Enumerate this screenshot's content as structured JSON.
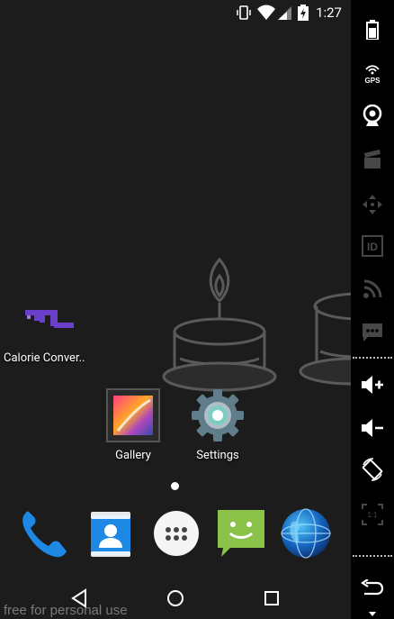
{
  "status_bar": {
    "time": "1:27"
  },
  "home": {
    "widget_app": {
      "label": "Calorie Conver.."
    },
    "apps": [
      {
        "label": "Gallery"
      },
      {
        "label": "Settings"
      }
    ],
    "page_indicator": {
      "pages": 1,
      "current": 1
    }
  },
  "dock": [
    {
      "name": "phone-icon"
    },
    {
      "name": "contacts-icon"
    },
    {
      "name": "all-apps-icon"
    },
    {
      "name": "messaging-icon"
    },
    {
      "name": "browser-icon"
    }
  ],
  "watermark": "free for personal use",
  "side_panel": {
    "top_items": [
      "battery",
      "gps",
      "camera",
      "clapper",
      "move",
      "id",
      "rss",
      "sms"
    ],
    "bottom_items": [
      "volume-up",
      "volume-down",
      "rotate",
      "scale"
    ],
    "back_item": "back",
    "disabled": [
      "clapper",
      "move",
      "id",
      "rss",
      "sms",
      "scale"
    ]
  },
  "colors": {
    "accent_teal": "#80cbc4",
    "dock_phone": "#1e88e5",
    "dock_sms": "#8bc34a"
  }
}
